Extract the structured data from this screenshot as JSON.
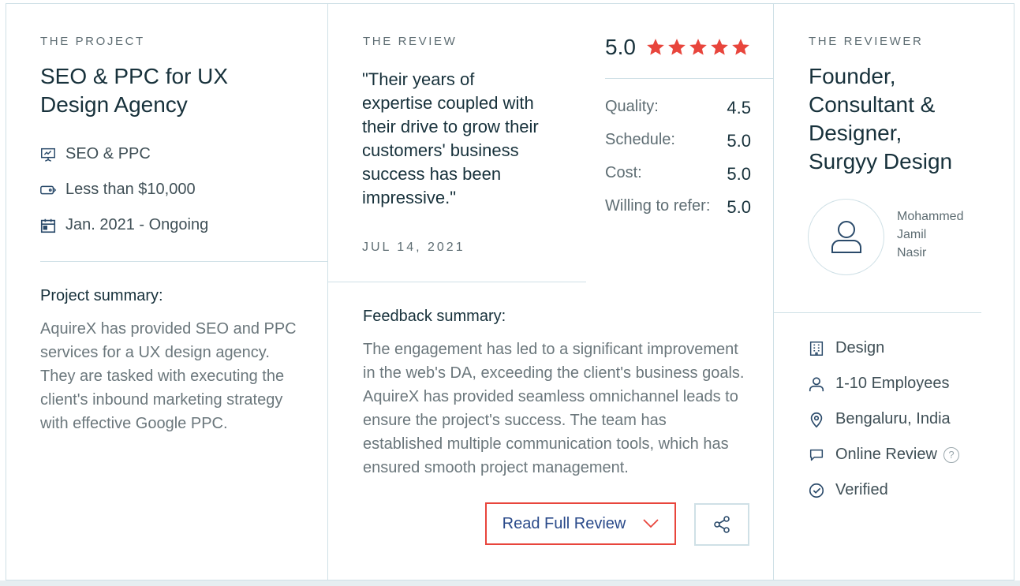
{
  "project": {
    "eyebrow": "THE PROJECT",
    "title_line1": "SEO & PPC for UX",
    "title_line2": "Design Agency",
    "service": "SEO & PPC",
    "budget": "Less than $10,000",
    "timeline": "Jan. 2021 - Ongoing",
    "summary_label": "Project summary:",
    "summary_lines": [
      "AquireX has provided SEO and PPC",
      "services for a UX design agency.",
      "They are tasked with executing the",
      "client's inbound marketing strategy",
      "with effective Google PPC."
    ]
  },
  "review": {
    "eyebrow": "THE REVIEW",
    "quote_lines": [
      "\"Their years of",
      "expertise coupled with",
      "their drive to grow their",
      "customers' business",
      "success has been",
      "impressive.\""
    ],
    "date": "JUL 14, 2021",
    "overall_score": "5.0",
    "overall_stars": 5,
    "ratings": [
      {
        "label": "Quality:",
        "value": "4.5"
      },
      {
        "label": "Schedule:",
        "value": "5.0"
      },
      {
        "label": "Cost:",
        "value": "5.0"
      },
      {
        "label": "Willing to refer:",
        "value": "5.0"
      }
    ],
    "feedback_label": "Feedback summary:",
    "feedback_lines": [
      "The engagement has led to a significant improvement",
      "in the web's DA, exceeding the client's business goals.",
      "AquireX has provided seamless omnichannel leads to",
      "ensure the project's success. The team has",
      "established multiple communication tools, which has",
      "ensured smooth project management."
    ],
    "read_full_label": "Read Full Review"
  },
  "reviewer": {
    "eyebrow": "THE REVIEWER",
    "title_lines": [
      "Founder,",
      "Consultant &",
      "Designer,",
      "Surgyy Design"
    ],
    "name_lines": [
      "Mohammed",
      "Jamil",
      "Nasir"
    ],
    "industry": "Design",
    "company_size": "1-10 Employees",
    "location": "Bengaluru, India",
    "review_type": "Online Review",
    "help_glyph": "?",
    "verification": "Verified"
  },
  "colors": {
    "star": "#e8453c",
    "accent_border": "#e8453c",
    "icon": "#2a4a6a",
    "divider": "#cfe0e6"
  }
}
